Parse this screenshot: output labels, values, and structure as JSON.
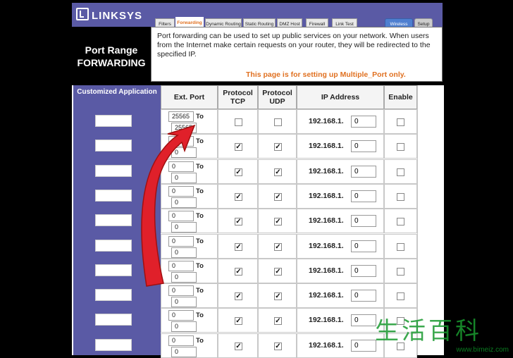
{
  "brand": {
    "logo_text": "LINKSYS"
  },
  "tabs": [
    {
      "label": "Filters",
      "active": false
    },
    {
      "label": "Forwarding",
      "active": true
    },
    {
      "label": "Dynamic Routing",
      "active": false
    },
    {
      "label": "Static Routing",
      "active": false
    },
    {
      "label": "DMZ Host",
      "active": false
    },
    {
      "label": "Firewall",
      "active": false
    },
    {
      "label": "Link Test",
      "active": false
    },
    {
      "label": "Wireless",
      "active": false
    },
    {
      "label": "Setup",
      "active": false
    }
  ],
  "page": {
    "title_line1": "Port Range",
    "title_line2": "FORWARDING",
    "description": "Port forwarding can be used to set up public services on your network. When users from the Internet make certain requests on your router, they will be redirected to the specified IP.",
    "note": "This page is for setting up Multiple_Port only."
  },
  "table": {
    "headers": {
      "app": "Customized Application",
      "ext_port": "Ext. Port",
      "tcp": "Protocol TCP",
      "udp": "Protocol UDP",
      "ip": "IP Address",
      "enable": "Enable"
    },
    "to_label": "To",
    "ip_prefix": "192.168.1.",
    "rows": [
      {
        "app": "",
        "start": "25565",
        "end": "25565",
        "tcp": false,
        "udp": false,
        "ip": "0",
        "enable": false
      },
      {
        "app": "",
        "start": "0",
        "end": "0",
        "tcp": true,
        "udp": true,
        "ip": "0",
        "enable": false
      },
      {
        "app": "",
        "start": "0",
        "end": "0",
        "tcp": true,
        "udp": true,
        "ip": "0",
        "enable": false
      },
      {
        "app": "",
        "start": "0",
        "end": "0",
        "tcp": true,
        "udp": true,
        "ip": "0",
        "enable": false
      },
      {
        "app": "",
        "start": "0",
        "end": "0",
        "tcp": true,
        "udp": true,
        "ip": "0",
        "enable": false
      },
      {
        "app": "",
        "start": "0",
        "end": "0",
        "tcp": true,
        "udp": true,
        "ip": "0",
        "enable": false
      },
      {
        "app": "",
        "start": "0",
        "end": "0",
        "tcp": true,
        "udp": true,
        "ip": "0",
        "enable": false
      },
      {
        "app": "",
        "start": "0",
        "end": "0",
        "tcp": true,
        "udp": true,
        "ip": "0",
        "enable": false
      },
      {
        "app": "",
        "start": "0",
        "end": "0",
        "tcp": true,
        "udp": true,
        "ip": "0",
        "enable": false
      },
      {
        "app": "",
        "start": "0",
        "end": "0",
        "tcp": true,
        "udp": true,
        "ip": "0",
        "enable": false
      }
    ]
  },
  "watermark": {
    "glyphs": "生活百科",
    "url": "www.bimeiz.com"
  },
  "colors": {
    "brand_blue": "#5a5aa5",
    "accent_orange": "#e07020",
    "arrow_red": "#e0202a"
  }
}
